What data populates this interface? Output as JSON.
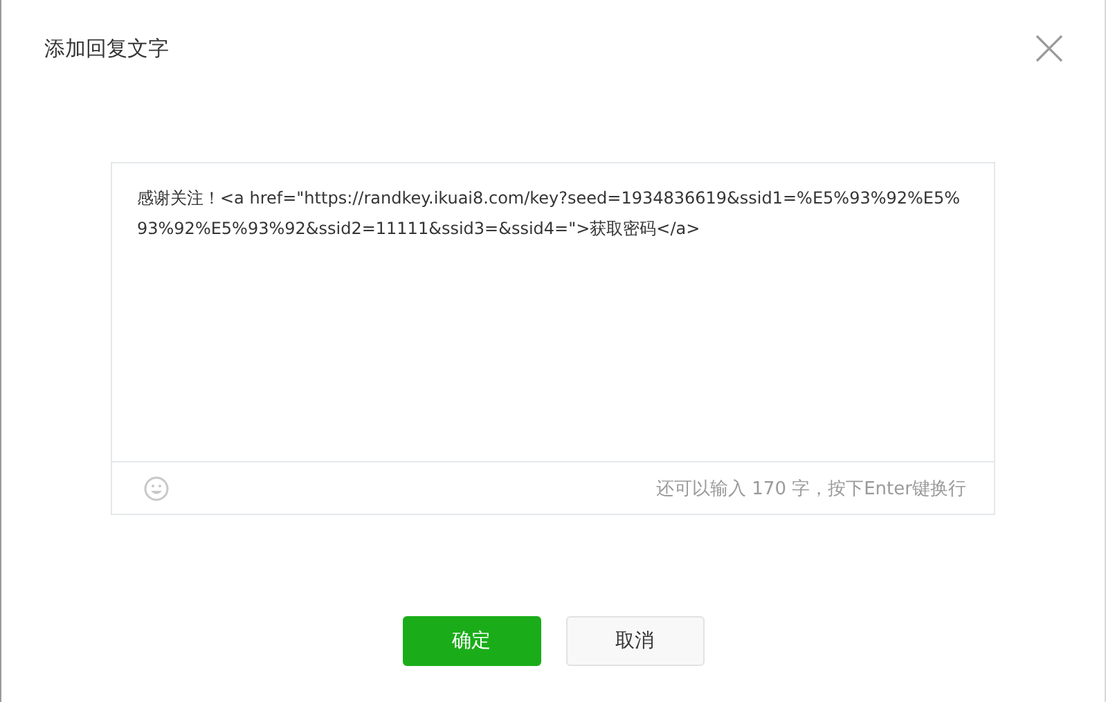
{
  "dialog": {
    "title": "添加回复文字"
  },
  "editor": {
    "value": "感谢关注！<a href=\"https://randkey.ikuai8.com/key?seed=1934836619&ssid1=%E5%93%92%E5%93%92%E5%93%92&ssid2=11111&ssid3=&ssid4=\">获取密码</a>",
    "counter": "还可以输入 170 字，按下Enter键换行"
  },
  "buttons": [
    {
      "label": "确定",
      "kind": "primary"
    },
    {
      "label": "取消",
      "kind": "secondary"
    }
  ]
}
